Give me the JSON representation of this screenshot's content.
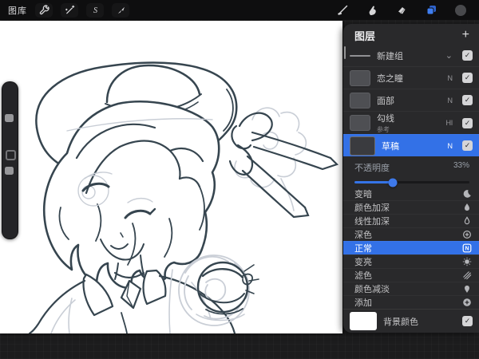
{
  "topbar": {
    "gallery_label": "图库",
    "left_tools": [
      "wrench-icon",
      "adjustments-wand-icon",
      "selection-s-icon",
      "transform-arrow-icon"
    ],
    "right_tools": [
      "brush-icon",
      "smudge-icon",
      "eraser-icon",
      "layers-icon",
      "color-swatch-icon"
    ]
  },
  "layers_panel": {
    "title": "图层",
    "add_button": "+",
    "layers": [
      {
        "name": "新建组",
        "type": "group"
      },
      {
        "name": "恋之瞳",
        "mode": "N",
        "visible": true
      },
      {
        "name": "面部",
        "mode": "N",
        "visible": true
      },
      {
        "name": "勾线",
        "sub": "参考",
        "mode": "Hl",
        "visible": true
      },
      {
        "name": "草稿",
        "mode": "N",
        "visible": true,
        "selected": true
      }
    ],
    "opacity": {
      "label": "不透明度",
      "value": "33%",
      "percent": 33
    },
    "blend_modes": [
      {
        "label": "变暗",
        "icon": "moon-icon"
      },
      {
        "label": "颜色加深",
        "icon": "color-burn-icon"
      },
      {
        "label": "线性加深",
        "icon": "linear-burn-icon"
      },
      {
        "label": "深色",
        "icon": "darker-color-icon"
      },
      {
        "label": "正常",
        "icon": "normal-n-icon",
        "selected": true
      },
      {
        "label": "变亮",
        "icon": "lighten-sun-icon"
      },
      {
        "label": "滤色",
        "icon": "screen-hatch-icon"
      },
      {
        "label": "颜色减淡",
        "icon": "color-dodge-icon"
      },
      {
        "label": "添加",
        "icon": "add-plus-icon"
      }
    ],
    "background_row": {
      "label": "背景颜色",
      "visible": true,
      "color": "#FFFFFF"
    }
  },
  "colors": {
    "accent_blue": "#3574E8",
    "panel_bg": "#29292B",
    "topbar_bg": "#0E0E0F",
    "app_bg": "#1C1C1D",
    "canvas_bg": "#FFFFFF",
    "ink_line": "#36454F",
    "sketch_gray": "#C9CED6"
  }
}
